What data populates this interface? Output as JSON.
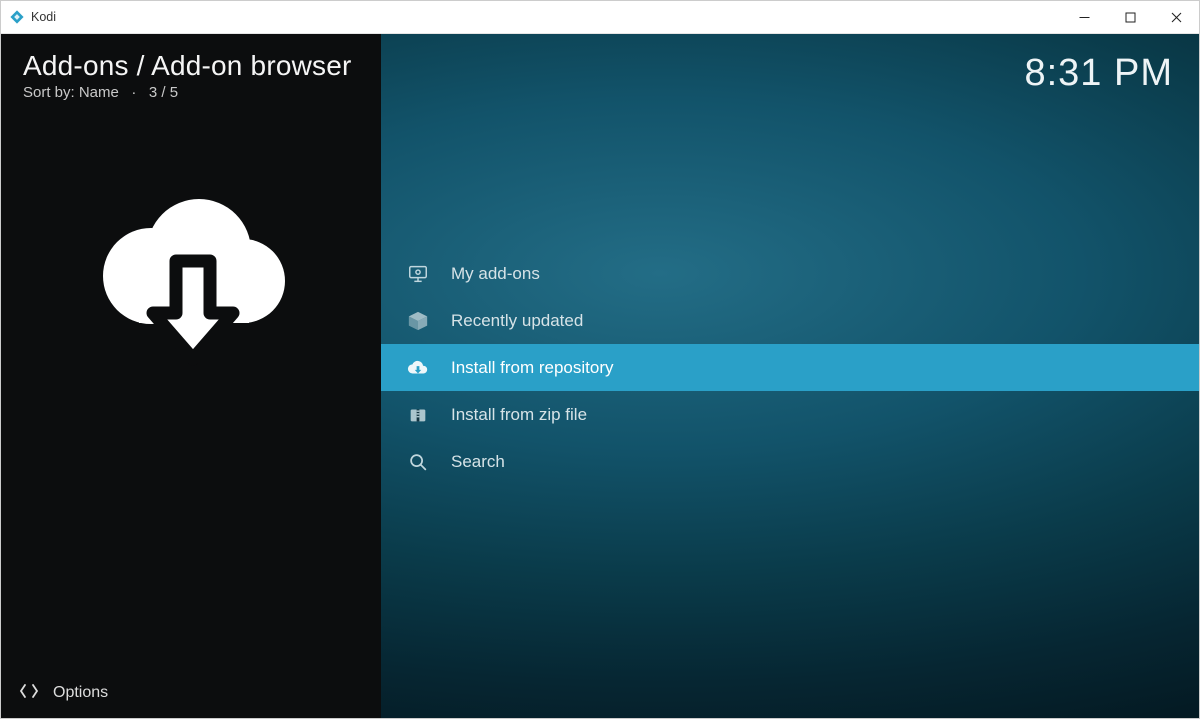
{
  "window": {
    "title": "Kodi"
  },
  "header": {
    "breadcrumb": "Add-ons / Add-on browser",
    "sort_label": "Sort by: Name",
    "position": "3 / 5",
    "clock": "8:31 PM"
  },
  "sidebar": {
    "options_label": "Options"
  },
  "menu": {
    "items": [
      {
        "label": "My add-ons",
        "icon": "monitor-icon",
        "selected": false
      },
      {
        "label": "Recently updated",
        "icon": "box-icon",
        "selected": false
      },
      {
        "label": "Install from repository",
        "icon": "cloud-icon",
        "selected": true
      },
      {
        "label": "Install from zip file",
        "icon": "zip-icon",
        "selected": false
      },
      {
        "label": "Search",
        "icon": "search-icon",
        "selected": false
      }
    ]
  }
}
